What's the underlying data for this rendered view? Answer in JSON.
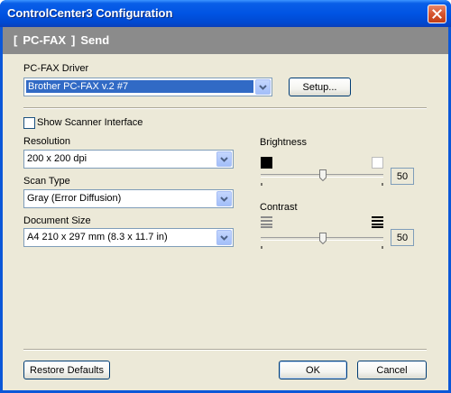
{
  "window": {
    "title": "ControlCenter3 Configuration",
    "close_icon": "close-icon"
  },
  "header": {
    "bracket_open": "[",
    "tab": "PC-FAX",
    "bracket_close": "]",
    "section": "Send"
  },
  "driver": {
    "label": "PC-FAX Driver",
    "value": "Brother PC-FAX v.2 #7",
    "setup_button": "Setup..."
  },
  "scanner_interface": {
    "label": "Show Scanner Interface",
    "checked": false
  },
  "resolution": {
    "label": "Resolution",
    "value": "200 x 200 dpi"
  },
  "scan_type": {
    "label": "Scan Type",
    "value": "Gray (Error Diffusion)"
  },
  "document_size": {
    "label": "Document Size",
    "value": "A4 210 x 297 mm (8.3 x 11.7 in)"
  },
  "brightness": {
    "label": "Brightness",
    "value": "50",
    "level": 0.5
  },
  "contrast": {
    "label": "Contrast",
    "value": "50",
    "level": 0.5
  },
  "footer": {
    "restore_defaults": "Restore Defaults",
    "ok": "OK",
    "cancel": "Cancel"
  }
}
